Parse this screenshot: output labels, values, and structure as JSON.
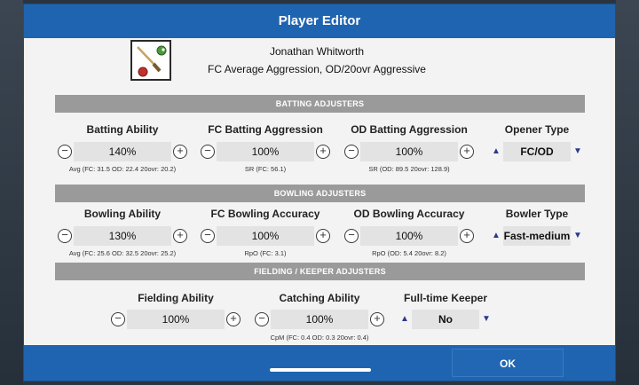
{
  "dialog": {
    "title": "Player Editor",
    "ok_label": "OK"
  },
  "player": {
    "name": "Jonathan Whitworth",
    "description": "FC Average Aggression, OD/20ovr Aggressive",
    "avatar_icon": "cricket-bat-ball-icon"
  },
  "sections": {
    "batting": "BATTING ADJUSTERS",
    "bowling": "BOWLING ADJUSTERS",
    "fielding": "FIELDING / KEEPER ADJUSTERS"
  },
  "batting": {
    "ability": {
      "label": "Batting Ability",
      "value": "140%",
      "stat": "Avg (FC: 31.5  OD: 22.4  20ovr: 20.2)"
    },
    "fc_aggression": {
      "label": "FC Batting Aggression",
      "value": "100%",
      "stat": "SR (FC: 56.1)"
    },
    "od_aggression": {
      "label": "OD Batting Aggression",
      "value": "100%",
      "stat": "SR (OD: 89.5  20ovr: 128.9)"
    },
    "opener_type": {
      "label": "Opener Type",
      "value": "FC/OD"
    }
  },
  "bowling": {
    "ability": {
      "label": "Bowling Ability",
      "value": "130%",
      "stat": "Avg (FC: 25.6  OD: 32.5  20ovr: 25.2)"
    },
    "fc_accuracy": {
      "label": "FC Bowling Accuracy",
      "value": "100%",
      "stat": "RpO (FC: 3.1)"
    },
    "od_accuracy": {
      "label": "OD Bowling Accuracy",
      "value": "100%",
      "stat": "RpO (OD: 5.4  20ovr: 8.2)"
    },
    "bowler_type": {
      "label": "Bowler Type",
      "value": "Fast-medium"
    }
  },
  "fielding": {
    "fielding_ability": {
      "label": "Fielding Ability",
      "value": "100%"
    },
    "catching_ability": {
      "label": "Catching Ability",
      "value": "100%",
      "stat": "CpM (FC: 0.4  OD: 0.3  20ovr: 0.4)"
    },
    "keeper": {
      "label": "Full-time Keeper",
      "value": "No"
    }
  },
  "glyphs": {
    "minus": "−",
    "plus": "+",
    "up": "▲",
    "down": "▼"
  },
  "colors": {
    "title_bar": "#1f64b0",
    "section_header": "#9a9a9a",
    "field_bg": "#e3e3e3",
    "arrow": "#2a3a8c"
  }
}
